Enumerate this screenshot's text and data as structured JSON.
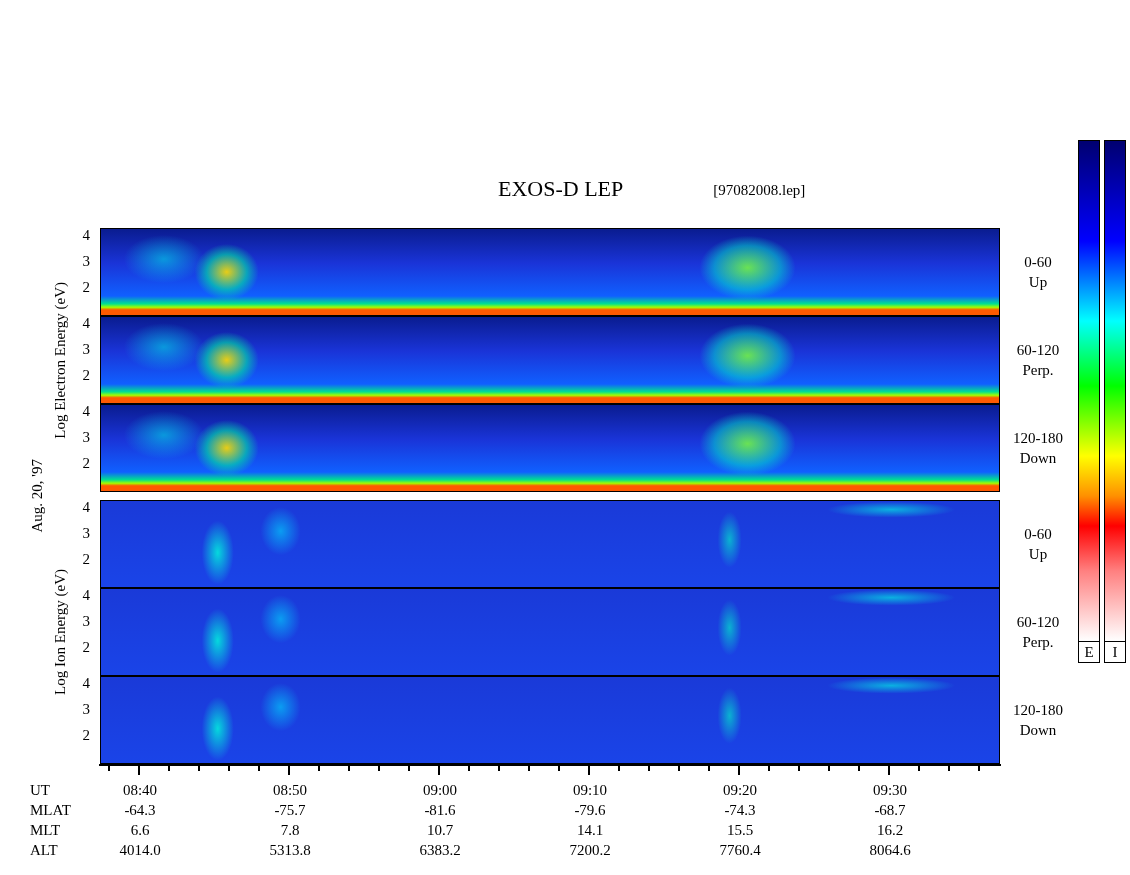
{
  "title": "EXOS-D LEP",
  "file": "[97082008.lep]",
  "date_label": "Aug. 20, '97",
  "groups": [
    {
      "kind": "electron",
      "axis_label": "Log Electron Energy (eV)",
      "panels": [
        {
          "y_ticks": [
            "4",
            "3",
            "2"
          ],
          "pitch": [
            "0-60",
            "Up"
          ]
        },
        {
          "y_ticks": [
            "4",
            "3",
            "2"
          ],
          "pitch": [
            "60-120",
            "Perp."
          ]
        },
        {
          "y_ticks": [
            "4",
            "3",
            "2"
          ],
          "pitch": [
            "120-180",
            "Down"
          ]
        }
      ]
    },
    {
      "kind": "ion",
      "axis_label": "Log Ion Energy (eV)",
      "panels": [
        {
          "y_ticks": [
            "4",
            "3",
            "2"
          ],
          "pitch": [
            "0-60",
            "Up"
          ]
        },
        {
          "y_ticks": [
            "4",
            "3",
            "2"
          ],
          "pitch": [
            "60-120",
            "Perp."
          ]
        },
        {
          "y_ticks": [
            "4",
            "3",
            "2"
          ],
          "pitch": [
            "120-180",
            "Down"
          ]
        }
      ]
    }
  ],
  "time_axis": [
    {
      "label": "UT",
      "values": [
        "08:40",
        "08:50",
        "09:00",
        "09:10",
        "09:20",
        "09:30"
      ]
    },
    {
      "label": "MLAT",
      "values": [
        "-64.3",
        "-75.7",
        "-81.6",
        "-79.6",
        "-74.3",
        "-68.7"
      ]
    },
    {
      "label": "MLT",
      "values": [
        "6.6",
        "7.8",
        "10.7",
        "14.1",
        "15.5",
        "16.2"
      ]
    },
    {
      "label": "ALT",
      "values": [
        "4014.0",
        "5313.8",
        "6383.2",
        "7200.2",
        "7760.4",
        "8064.6"
      ]
    }
  ],
  "colorbars": [
    {
      "label": "E"
    },
    {
      "label": "I"
    }
  ]
}
